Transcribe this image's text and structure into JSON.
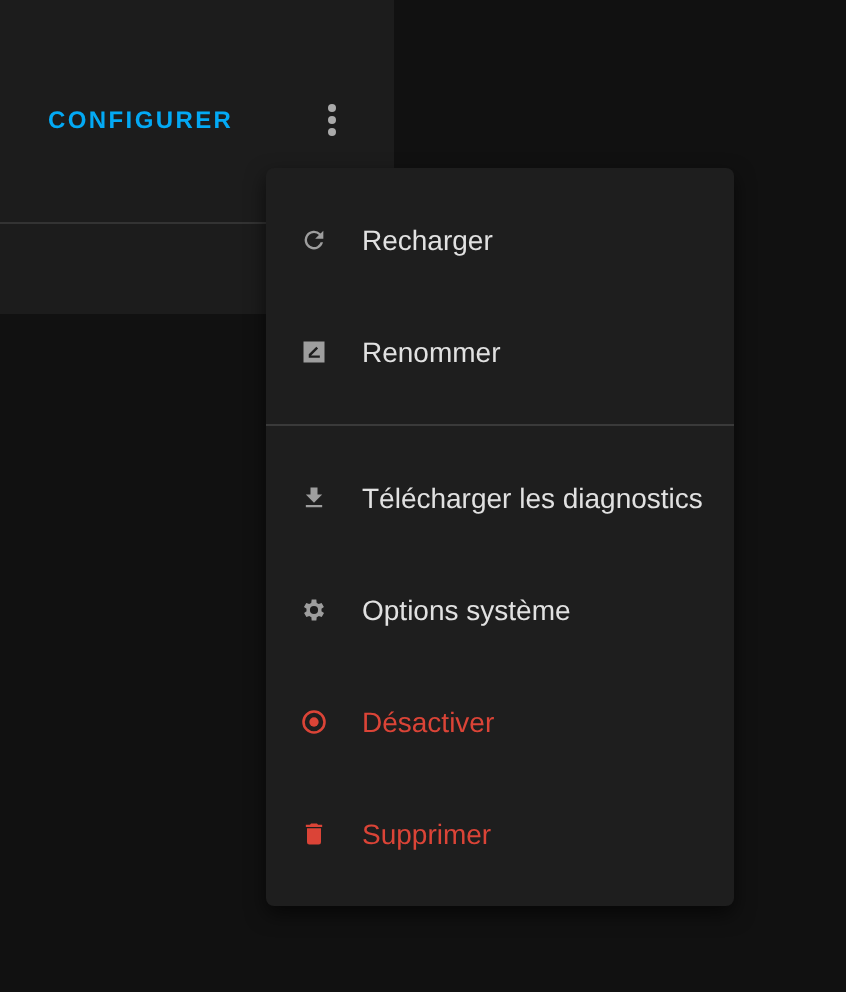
{
  "card": {
    "action_button": "CONFIGURER"
  },
  "menu": {
    "groups": [
      [
        {
          "label": "Recharger",
          "kind": "normal"
        },
        {
          "label": "Renommer",
          "kind": "normal"
        }
      ],
      [
        {
          "label": "Télécharger les diagnostics",
          "kind": "normal"
        },
        {
          "label": "Options système",
          "kind": "normal"
        },
        {
          "label": "Désactiver",
          "kind": "danger"
        },
        {
          "label": "Supprimer",
          "kind": "danger"
        }
      ]
    ]
  }
}
